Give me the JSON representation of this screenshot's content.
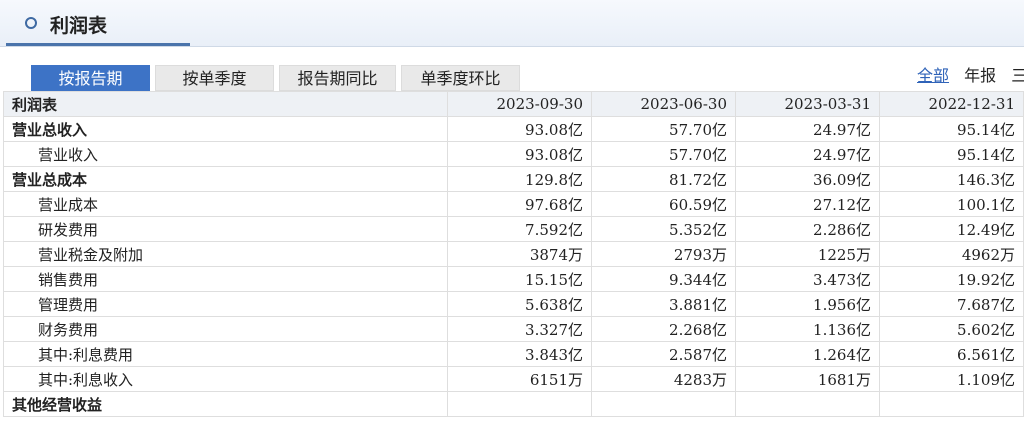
{
  "header": {
    "title": "利润表"
  },
  "tabs": [
    {
      "label": "按报告期",
      "active": true
    },
    {
      "label": "按单季度",
      "active": false
    },
    {
      "label": "报告期同比",
      "active": false
    },
    {
      "label": "单季度环比",
      "active": false
    }
  ],
  "periods": [
    "全部",
    "年报",
    "三"
  ],
  "table": {
    "corner": "利润表",
    "dates": [
      "2023-09-30",
      "2023-06-30",
      "2023-03-31",
      "2022-12-31"
    ],
    "rows": [
      {
        "label": "营业总收入",
        "bold": true,
        "values": [
          "93.08亿",
          "57.70亿",
          "24.97亿",
          "95.14亿"
        ]
      },
      {
        "label": "营业收入",
        "bold": false,
        "values": [
          "93.08亿",
          "57.70亿",
          "24.97亿",
          "95.14亿"
        ]
      },
      {
        "label": "营业总成本",
        "bold": true,
        "values": [
          "129.8亿",
          "81.72亿",
          "36.09亿",
          "146.3亿"
        ]
      },
      {
        "label": "营业成本",
        "bold": false,
        "values": [
          "97.68亿",
          "60.59亿",
          "27.12亿",
          "100.1亿"
        ]
      },
      {
        "label": "研发费用",
        "bold": false,
        "values": [
          "7.592亿",
          "5.352亿",
          "2.286亿",
          "12.49亿"
        ]
      },
      {
        "label": "营业税金及附加",
        "bold": false,
        "values": [
          "3874万",
          "2793万",
          "1225万",
          "4962万"
        ]
      },
      {
        "label": "销售费用",
        "bold": false,
        "values": [
          "15.15亿",
          "9.344亿",
          "3.473亿",
          "19.92亿"
        ]
      },
      {
        "label": "管理费用",
        "bold": false,
        "values": [
          "5.638亿",
          "3.881亿",
          "1.956亿",
          "7.687亿"
        ]
      },
      {
        "label": "财务费用",
        "bold": false,
        "values": [
          "3.327亿",
          "2.268亿",
          "1.136亿",
          "5.602亿"
        ]
      },
      {
        "label": "其中:利息费用",
        "bold": false,
        "values": [
          "3.843亿",
          "2.587亿",
          "1.264亿",
          "6.561亿"
        ]
      },
      {
        "label": "其中:利息收入",
        "bold": false,
        "values": [
          "6151万",
          "4283万",
          "1681万",
          "1.109亿"
        ]
      },
      {
        "label": "其他经营收益",
        "bold": true,
        "values": [
          "",
          "",
          "",
          ""
        ]
      }
    ]
  }
}
